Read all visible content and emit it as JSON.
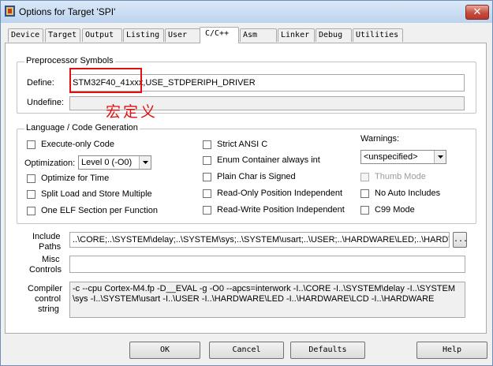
{
  "window": {
    "title": "Options for Target 'SPI'",
    "close_glyph": "✕"
  },
  "tabs": [
    "Device",
    "Target",
    "Output",
    "Listing",
    "User",
    "C/C++",
    "Asm",
    "Linker",
    "Debug",
    "Utilities"
  ],
  "active_tab": "C/C++",
  "preprocessor": {
    "legend": "Preprocessor Symbols",
    "define_label": "Define:",
    "define_value": "STM32F40_41xxx,USE_STDPERIPH_DRIVER",
    "undefine_label": "Undefine:",
    "undefine_value": ""
  },
  "annotation": {
    "text": "宏定义",
    "color": "#e01010"
  },
  "language": {
    "legend": "Language / Code Generation",
    "execute_only": "Execute-only Code",
    "optimization_label": "Optimization:",
    "optimization_value": "Level 0 (-O0)",
    "optimize_time": "Optimize for Time",
    "split_load": "Split Load and Store Multiple",
    "one_elf": "One ELF Section per Function",
    "strict_ansi": "Strict ANSI C",
    "enum_container": "Enum Container always int",
    "plain_char": "Plain Char is Signed",
    "ro_pi": "Read-Only Position Independent",
    "rw_pi": "Read-Write Position Independent",
    "warnings_label": "Warnings:",
    "warnings_value": "<unspecified>",
    "thumb_mode": "Thumb Mode",
    "no_auto_includes": "No Auto Includes",
    "c99": "C99 Mode"
  },
  "include": {
    "label_line1": "Include",
    "label_line2": "Paths",
    "value": "..\\CORE;..\\SYSTEM\\delay;..\\SYSTEM\\sys;..\\SYSTEM\\usart;..\\USER;..\\HARDWARE\\LED;..\\HARDWARE\\LCD;..\\HARDWARE",
    "browse": "..."
  },
  "misc": {
    "label_line1": "Misc",
    "label_line2": "Controls",
    "value": ""
  },
  "compiler": {
    "label_line1": "Compiler",
    "label_line2": "control",
    "label_line3": "string",
    "line1": "-c --cpu Cortex-M4.fp -D__EVAL -g -O0 --apcs=interwork -I..\\CORE -I..\\SYSTEM\\delay -I..\\SYSTEM",
    "line2": "\\sys -I..\\SYSTEM\\usart -I..\\USER -I..\\HARDWARE\\LED -I..\\HARDWARE\\LCD -I..\\HARDWARE"
  },
  "buttons": {
    "ok": "OK",
    "cancel": "Cancel",
    "defaults": "Defaults",
    "help": "Help"
  }
}
